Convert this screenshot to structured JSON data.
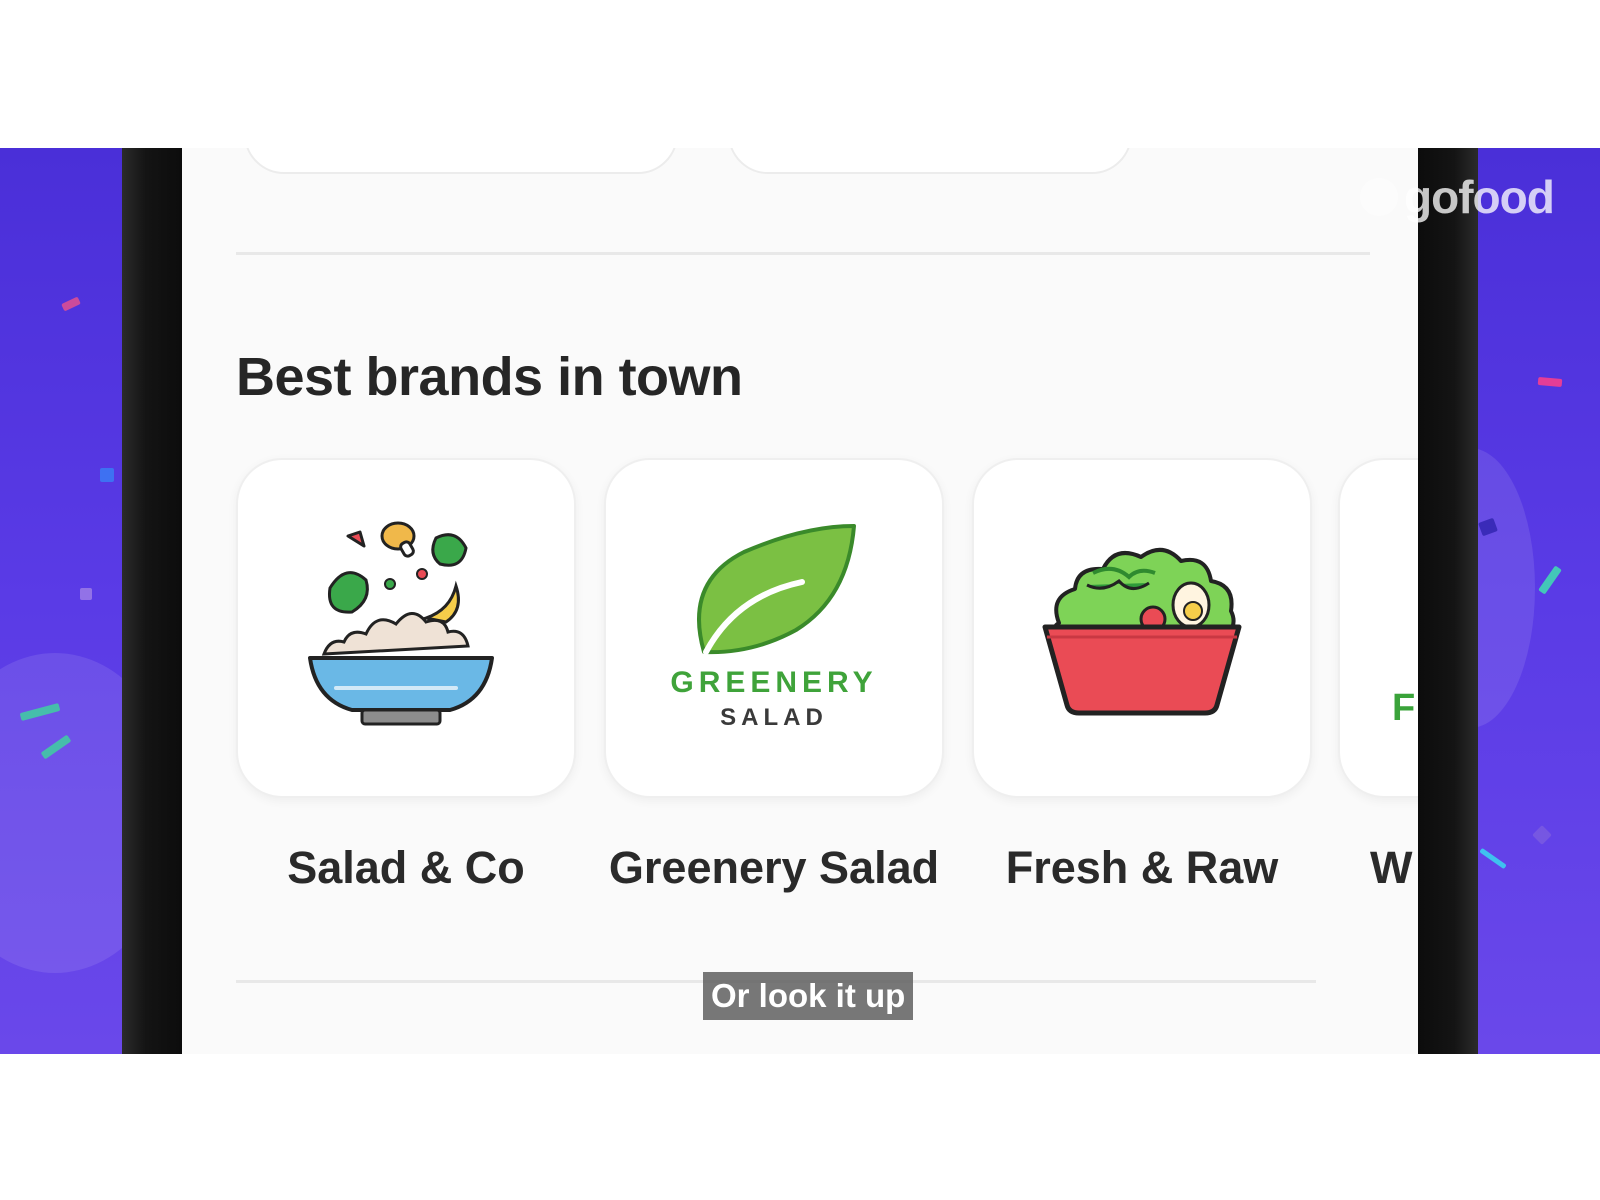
{
  "app": {
    "watermark": "gofood"
  },
  "section": {
    "title": "Best brands in town"
  },
  "brands": [
    {
      "name": "Salad & Co",
      "logo_icon": "salad-bowl-icon"
    },
    {
      "name": "Greenery Salad",
      "logo_line1": "GREENERY",
      "logo_line2": "SALAD",
      "logo_icon": "leaf-icon"
    },
    {
      "name": "Fresh & Raw",
      "logo_icon": "red-salad-bowl-icon"
    },
    {
      "name": "W",
      "logo_letter": "F"
    }
  ],
  "caption": {
    "text": "Or look it up"
  },
  "colors": {
    "background_purple": "#5a3be6",
    "screen_bg": "#fafafa",
    "greenery_green": "#3fa33a",
    "bowl_blue": "#6ab8e6",
    "bowl_red": "#ea4b55"
  }
}
